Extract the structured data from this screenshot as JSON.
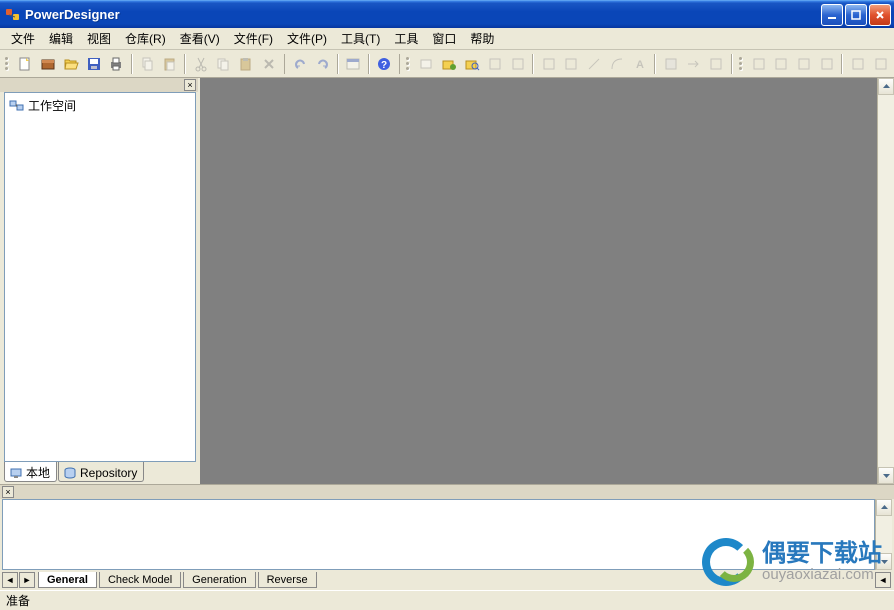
{
  "window": {
    "title": "PowerDesigner"
  },
  "menu": {
    "items": [
      "文件",
      "编辑",
      "视图",
      "仓库(R)",
      "查看(V)",
      "文件(F)",
      "文件(P)",
      "工具(T)",
      "工具",
      "窗口",
      "帮助"
    ]
  },
  "sidebar": {
    "workspace_label": "工作空间",
    "tabs": {
      "local": "本地",
      "repository": "Repository"
    }
  },
  "output": {
    "tabs": [
      "General",
      "Check Model",
      "Generation",
      "Reverse"
    ]
  },
  "status": {
    "text": "准备"
  },
  "watermark": {
    "cn": "偶要下载站",
    "en": "ouyaoxiazai.com"
  }
}
